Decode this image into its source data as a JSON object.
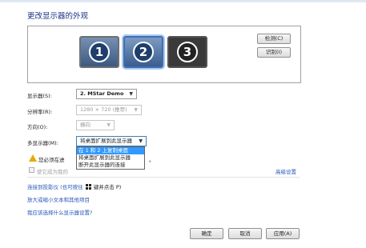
{
  "title": "更改显示器的外观",
  "monitors": [
    {
      "number": "1"
    },
    {
      "number": "2"
    },
    {
      "number": "3"
    }
  ],
  "buttons": {
    "detect": "检测(C)",
    "identify": "识别(I)",
    "ok": "确定",
    "cancel": "取消",
    "apply": "应用(A)"
  },
  "settings": {
    "display_label": "显示器(S):",
    "display_value": "2. MStar Demo",
    "resolution_label": "分辨率(R):",
    "resolution_value": "1280 × 720 (推荐)",
    "orientation_label": "方向(O):",
    "orientation_value": "横向",
    "multi_label": "多显示器(M):",
    "multi_value": "将桌面扩展到此显示器"
  },
  "dropdown_options": [
    {
      "label": "在 1 和 2 上复制桌面",
      "selected": true
    },
    {
      "label": "将桌面扩展到此显示器",
      "selected": false
    },
    {
      "label": "断开此显示器的连接",
      "selected": false
    }
  ],
  "warning": {
    "prefix": "您必须在进",
    "suffix": "。"
  },
  "checkbox": {
    "label": "使它成为我的"
  },
  "advanced_link": "高级设置",
  "links": {
    "projector_prefix": "连接到投影仪 (也可按住",
    "projector_suffix": "键并点击 P)",
    "text_size": "放大或缩小文本和其他项目",
    "help": "我应该选择什么显示器设置?"
  }
}
